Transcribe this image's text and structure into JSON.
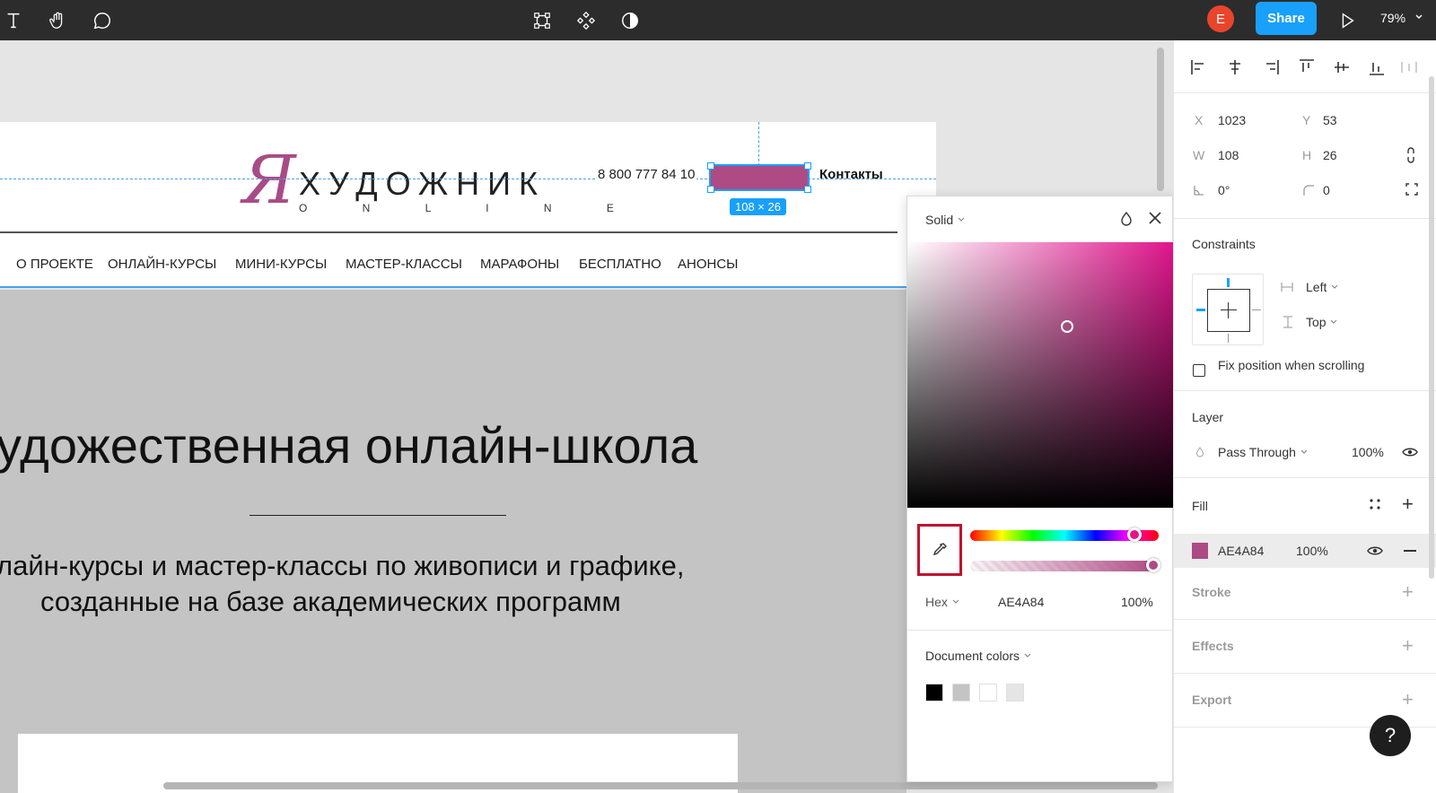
{
  "toolbar": {
    "avatar_initial": "E",
    "share_label": "Share",
    "zoom_level": "79%",
    "icons": [
      "text-tool-icon",
      "hand-tool-icon",
      "comment-icon",
      "frame-icon",
      "component-icon",
      "contrast-icon",
      "play-icon"
    ]
  },
  "website": {
    "logo_text": "ХУДОЖНИК",
    "logo_sub": "O N L I N E",
    "phone": "8 800 777 84 10",
    "contacts": "Контакты",
    "nav": [
      "О ПРОЕКТЕ",
      "ОНЛАЙН-КУРСЫ",
      "МИНИ-КУРСЫ",
      "МАСТЕР-КЛАССЫ",
      "МАРАФОНЫ",
      "БЕСПЛАТНО",
      "АНОНСЫ"
    ],
    "hero_title": "удожественная онлайн-школа",
    "hero_sub_1": "лайн-курсы и мастер-классы по живописи и графике,",
    "hero_sub_2": "созданные на базе академических программ"
  },
  "selection": {
    "badge": "108 × 26",
    "fill_color": "#AE4A84"
  },
  "color_picker": {
    "mode": "Solid",
    "format": "Hex",
    "hex": "AE4A84",
    "opacity": "100%",
    "document_colors_label": "Document colors",
    "swatches": [
      "#000000",
      "#C4C4C4",
      "#FFFFFF",
      "#E5E5E5"
    ]
  },
  "panel": {
    "x_label": "X",
    "x_value": "1023",
    "y_label": "Y",
    "y_value": "53",
    "w_label": "W",
    "w_value": "108",
    "h_label": "H",
    "h_value": "26",
    "rotation": "0°",
    "radius": "0",
    "constraints_title": "Constraints",
    "constraint_h": "Left",
    "constraint_v": "Top",
    "fix_position": "Fix position when scrolling",
    "layer_title": "Layer",
    "blend_mode": "Pass Through",
    "layer_opacity": "100%",
    "fill_title": "Fill",
    "fill_hex": "AE4A84",
    "fill_opacity": "100%",
    "stroke_title": "Stroke",
    "effects_title": "Effects",
    "export_title": "Export",
    "help": "?"
  },
  "colors": {
    "accent": "#18A0FB",
    "selection_fill": "#AE4A84",
    "toolbar_bg": "#2C2C2C"
  }
}
